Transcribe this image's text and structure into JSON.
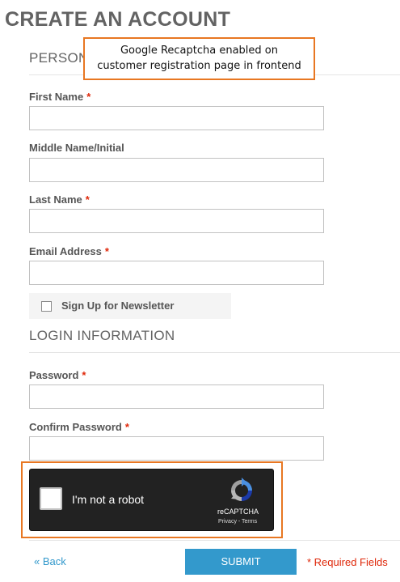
{
  "page": {
    "title": "CREATE AN ACCOUNT"
  },
  "sections": {
    "personal_title": "PERSONAL INFORMATION",
    "login_title": "LOGIN INFORMATION"
  },
  "callout": {
    "line1": "Google Recaptcha enabled on",
    "line2": "customer registration page in frontend"
  },
  "fields": {
    "first_name": {
      "label": "First Name",
      "required": "*",
      "value": ""
    },
    "middle_name": {
      "label": "Middle Name/Initial",
      "value": ""
    },
    "last_name": {
      "label": "Last Name",
      "required": "*",
      "value": ""
    },
    "email": {
      "label": "Email Address",
      "required": "*",
      "value": ""
    },
    "password": {
      "label": "Password",
      "required": "*",
      "value": ""
    },
    "confirm_password": {
      "label": "Confirm Password",
      "required": "*",
      "value": ""
    }
  },
  "newsletter": {
    "label": "Sign Up for Newsletter",
    "checked": false
  },
  "recaptcha": {
    "label": "I'm not a robot",
    "brand": "reCAPTCHA",
    "links": "Privacy - Terms",
    "logo_icon": "recaptcha-logo-icon"
  },
  "actions": {
    "back_label": "« Back",
    "submit_label": "SUBMIT",
    "required_note": "* Required Fields"
  },
  "colors": {
    "accent": "#3399cc",
    "required": "#df280a",
    "callout_border": "#e87722",
    "recaptcha_bg": "#222222"
  }
}
